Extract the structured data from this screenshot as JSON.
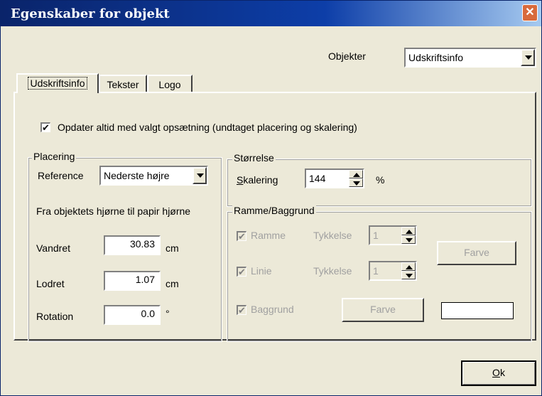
{
  "window": {
    "title": "Egenskaber for objekt",
    "close_glyph": "✕"
  },
  "objects": {
    "label": "Objekter",
    "value": "Udskriftsinfo"
  },
  "tabs": [
    {
      "label": "Udskriftsinfo"
    },
    {
      "label": "Tekster"
    },
    {
      "label": "Logo"
    }
  ],
  "update_checkbox": {
    "label": "Opdater altid med valgt opsætning (undtaget placering og skalering)",
    "mark": "✔"
  },
  "placement": {
    "legend": "Placering",
    "reference_label": "Reference",
    "reference_value": "Nederste højre",
    "note": "Fra objektets hjørne til papir hjørne",
    "horizontal_label": "Vandret",
    "horizontal_value": "30.83",
    "horizontal_unit": "cm",
    "vertical_label": "Lodret",
    "vertical_value": "1.07",
    "vertical_unit": "cm",
    "rotation_label": "Rotation",
    "rotation_value": "0.0",
    "rotation_unit": "°"
  },
  "size": {
    "legend": "Størrelse",
    "scaling_label_first": "S",
    "scaling_label_rest": "kalering",
    "scaling_value": "144",
    "scaling_unit": "%"
  },
  "frame": {
    "legend": "Ramme/Baggrund",
    "mark": "✔",
    "frame_label": "Ramme",
    "frame_thickness_label": "Tykkelse",
    "frame_thickness_value": "1",
    "line_label": "Linie",
    "line_thickness_label": "Tykkelse",
    "line_thickness_value": "1",
    "color_button_label": "Farve",
    "background_label": "Baggrund",
    "background_color_button_label": "Farve",
    "background_color": "#ffffff"
  },
  "ok_button": {
    "label_first": "O",
    "label_rest": "k"
  }
}
